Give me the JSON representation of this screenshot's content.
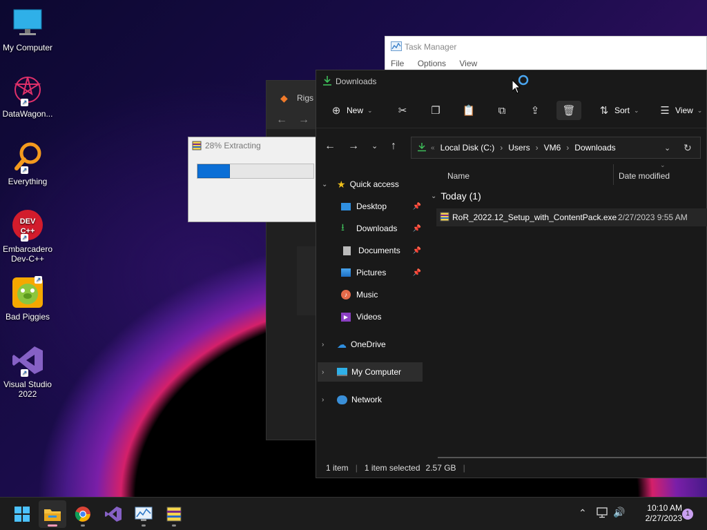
{
  "desktop": {
    "icons": [
      {
        "label": "My Computer"
      },
      {
        "label": "DataWagon..."
      },
      {
        "label": "Everything"
      },
      {
        "label": "Embarcadero Dev-C++"
      },
      {
        "label": "Bad Piggies"
      },
      {
        "label": "Visual Studio 2022"
      }
    ]
  },
  "task_manager": {
    "title": "Task Manager",
    "menu": [
      "File",
      "Options",
      "View"
    ]
  },
  "rigs": {
    "title": "Rigs o"
  },
  "extract": {
    "title": "28% Extracting",
    "progress": 0.28
  },
  "explorer": {
    "title": "Downloads",
    "toolbar": {
      "new": "New",
      "sort": "Sort",
      "view": "View"
    },
    "breadcrumb": [
      "Local Disk (C:)",
      "Users",
      "VM6",
      "Downloads"
    ],
    "nav": {
      "quick_access": "Quick access",
      "items": [
        {
          "label": "Desktop",
          "pinned": true
        },
        {
          "label": "Downloads",
          "pinned": true
        },
        {
          "label": "Documents",
          "pinned": true
        },
        {
          "label": "Pictures",
          "pinned": true
        },
        {
          "label": "Music",
          "pinned": false
        },
        {
          "label": "Videos",
          "pinned": false
        }
      ],
      "onedrive": "OneDrive",
      "my_computer": "My Computer",
      "network": "Network"
    },
    "columns": {
      "name": "Name",
      "date": "Date modified"
    },
    "group": "Today (1)",
    "files": [
      {
        "name": "RoR_2022.12_Setup_with_ContentPack.exe",
        "date": "2/27/2023 9:55 AM"
      }
    ],
    "status": {
      "count": "1 item",
      "selected": "1 item selected",
      "size": "2.57 GB"
    }
  },
  "taskbar": {
    "time": "10:10 AM",
    "date": "2/27/2023",
    "notifications": "1"
  },
  "colors": {
    "accent": "#0b6fd6",
    "explorer_bg": "#191919",
    "taskbar_bg": "#1c1c1c"
  }
}
